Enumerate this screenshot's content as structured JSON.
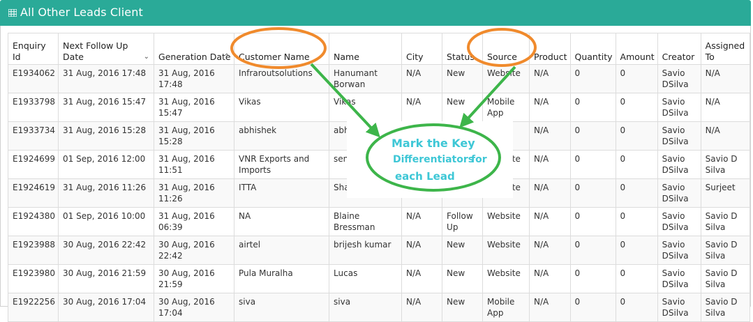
{
  "panel": {
    "title": "All Other Leads Client"
  },
  "columns": [
    {
      "label": "Enquiry Id"
    },
    {
      "label": "Next Follow Up Date"
    },
    {
      "label": "Generation Date"
    },
    {
      "label": "Customer Name"
    },
    {
      "label": "Name"
    },
    {
      "label": "City"
    },
    {
      "label": "Status"
    },
    {
      "label": "Source"
    },
    {
      "label": "Product"
    },
    {
      "label": "Quantity"
    },
    {
      "label": "Amount"
    },
    {
      "label": "Creator"
    },
    {
      "label": "Assigned To"
    }
  ],
  "sort": {
    "next_follow_up": "descending",
    "generation_date": "ascending"
  },
  "rows": [
    [
      "E1934062",
      "31 Aug, 2016 17:48",
      "31 Aug, 2016 17:48",
      "Infraroutsolutions",
      "Hanumant Borwan",
      "N/A",
      "New",
      "Website",
      "N/A",
      "0",
      "0",
      "Savio DSilva",
      "N/A"
    ],
    [
      "E1933798",
      "31 Aug, 2016 15:47",
      "31 Aug, 2016 15:47",
      "Vikas",
      "Vikas",
      "N/A",
      "New",
      "Mobile App",
      "N/A",
      "0",
      "0",
      "Savio DSilva",
      "N/A"
    ],
    [
      "E1933734",
      "31 Aug, 2016 15:28",
      "31 Aug, 2016 15:28",
      "abhishek",
      "abhishek",
      "",
      "",
      "",
      "N/A",
      "0",
      "0",
      "Savio DSilva",
      "N/A"
    ],
    [
      "E1924699",
      "01 Sep, 2016 12:00",
      "31 Aug, 2016 11:51",
      "VNR Exports and Imports",
      "senthil",
      "",
      "",
      "Website",
      "N/A",
      "0",
      "0",
      "Savio DSilva",
      "Savio D Silva"
    ],
    [
      "E1924619",
      "31 Aug, 2016 11:26",
      "31 Aug, 2016 11:26",
      "ITTA",
      "Shankar",
      "",
      "",
      "Website",
      "N/A",
      "0",
      "0",
      "Savio DSilva",
      "Surjeet"
    ],
    [
      "E1924380",
      "01 Sep, 2016 10:00",
      "31 Aug, 2016 06:39",
      "NA",
      "Blaine Bressman",
      "N/A",
      "Follow Up",
      "Website",
      "N/A",
      "0",
      "0",
      "Savio DSilva",
      "Savio D Silva"
    ],
    [
      "E1923988",
      "30 Aug, 2016 22:42",
      "30 Aug, 2016 22:42",
      "airtel",
      "brijesh kumar",
      "N/A",
      "New",
      "Website",
      "N/A",
      "0",
      "0",
      "Savio DSilva",
      "Savio D Silva"
    ],
    [
      "E1923980",
      "30 Aug, 2016 21:59",
      "30 Aug, 2016 21:59",
      "Pula Muralha",
      "Lucas",
      "N/A",
      "New",
      "Website",
      "N/A",
      "0",
      "0",
      "Savio DSilva",
      "Savio D Silva"
    ],
    [
      "E1922256",
      "30 Aug, 2016 17:04",
      "30 Aug, 2016 17:04",
      "siva",
      "siva",
      "N/A",
      "New",
      "Mobile App",
      "N/A",
      "0",
      "0",
      "Savio DSilva",
      "Savio D Silva"
    ]
  ],
  "annotation": {
    "line1": "Mark the Key",
    "line2a": "Differentiators",
    "line2b": "for",
    "line3": "each Lead",
    "highlight_color": "#f08a2c",
    "callout_color": "#3db54a",
    "text_color": "#3ec7d6"
  },
  "theme": {
    "header_bg": "#2aaa98"
  }
}
